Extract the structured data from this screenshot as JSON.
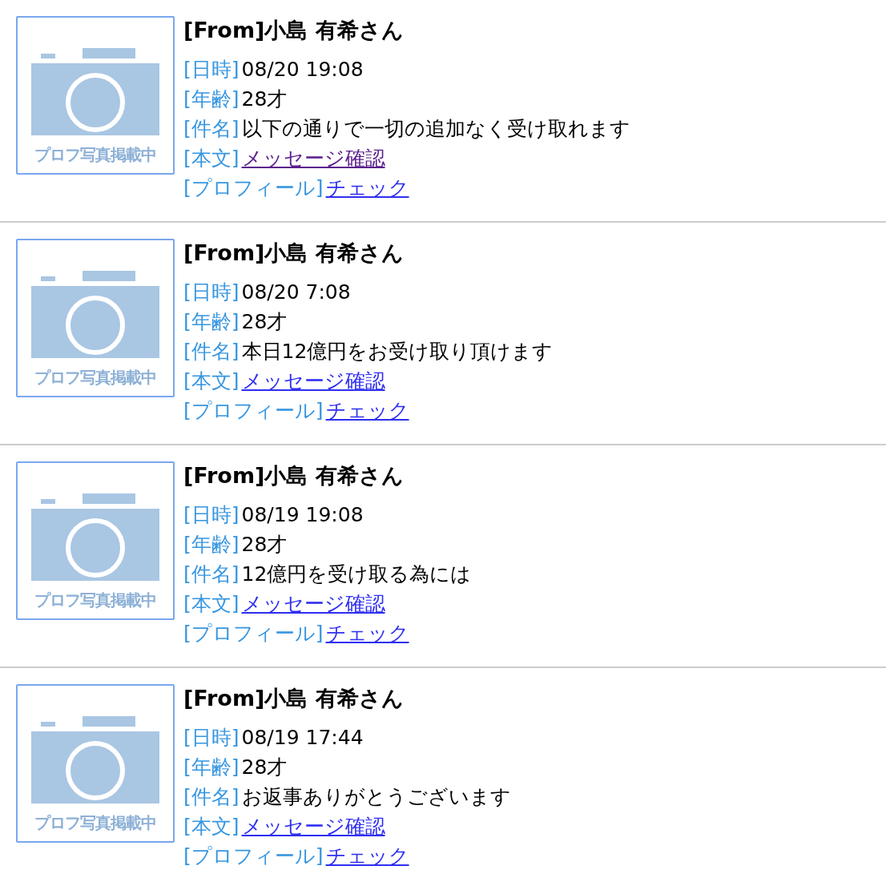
{
  "messages": [
    {
      "photo_label": "プロフ写真掲載中",
      "from": "[From]小島 有希さん",
      "fields": [
        {
          "label": "[日時]",
          "kind": "text",
          "value": "08/20 19:08"
        },
        {
          "label": "[年齢]",
          "kind": "text",
          "value": "28才"
        },
        {
          "label": "[件名]",
          "kind": "text",
          "value": "以下の通りで一切の追加なく受け取れます"
        },
        {
          "label": "[本文]",
          "kind": "link",
          "value": "メッセージ確認",
          "visited": true
        },
        {
          "label": "[プロフィール]",
          "kind": "link",
          "value": "チェック",
          "visited": false
        }
      ]
    },
    {
      "photo_label": "プロフ写真掲載中",
      "from": "[From]小島 有希さん",
      "fields": [
        {
          "label": "[日時]",
          "kind": "text",
          "value": "08/20 7:08"
        },
        {
          "label": "[年齢]",
          "kind": "text",
          "value": "28才"
        },
        {
          "label": "[件名]",
          "kind": "text",
          "value": "本日12億円をお受け取り頂けます"
        },
        {
          "label": "[本文]",
          "kind": "link",
          "value": "メッセージ確認",
          "visited": false
        },
        {
          "label": "[プロフィール]",
          "kind": "link",
          "value": "チェック",
          "visited": false
        }
      ]
    },
    {
      "photo_label": "プロフ写真掲載中",
      "from": "[From]小島 有希さん",
      "fields": [
        {
          "label": "[日時]",
          "kind": "text",
          "value": "08/19 19:08"
        },
        {
          "label": "[年齢]",
          "kind": "text",
          "value": "28才"
        },
        {
          "label": "[件名]",
          "kind": "text",
          "value": "12億円を受け取る為には"
        },
        {
          "label": "[本文]",
          "kind": "link",
          "value": "メッセージ確認",
          "visited": false
        },
        {
          "label": "[プロフィール]",
          "kind": "link",
          "value": "チェック",
          "visited": false
        }
      ]
    },
    {
      "photo_label": "プロフ写真掲載中",
      "from": "[From]小島 有希さん",
      "fields": [
        {
          "label": "[日時]",
          "kind": "text",
          "value": "08/19 17:44"
        },
        {
          "label": "[年齢]",
          "kind": "text",
          "value": "28才"
        },
        {
          "label": "[件名]",
          "kind": "text",
          "value": "お返事ありがとうございます"
        },
        {
          "label": "[本文]",
          "kind": "link",
          "value": "メッセージ確認",
          "visited": false
        },
        {
          "label": "[プロフィール]",
          "kind": "link",
          "value": "チェック",
          "visited": false
        }
      ]
    }
  ]
}
